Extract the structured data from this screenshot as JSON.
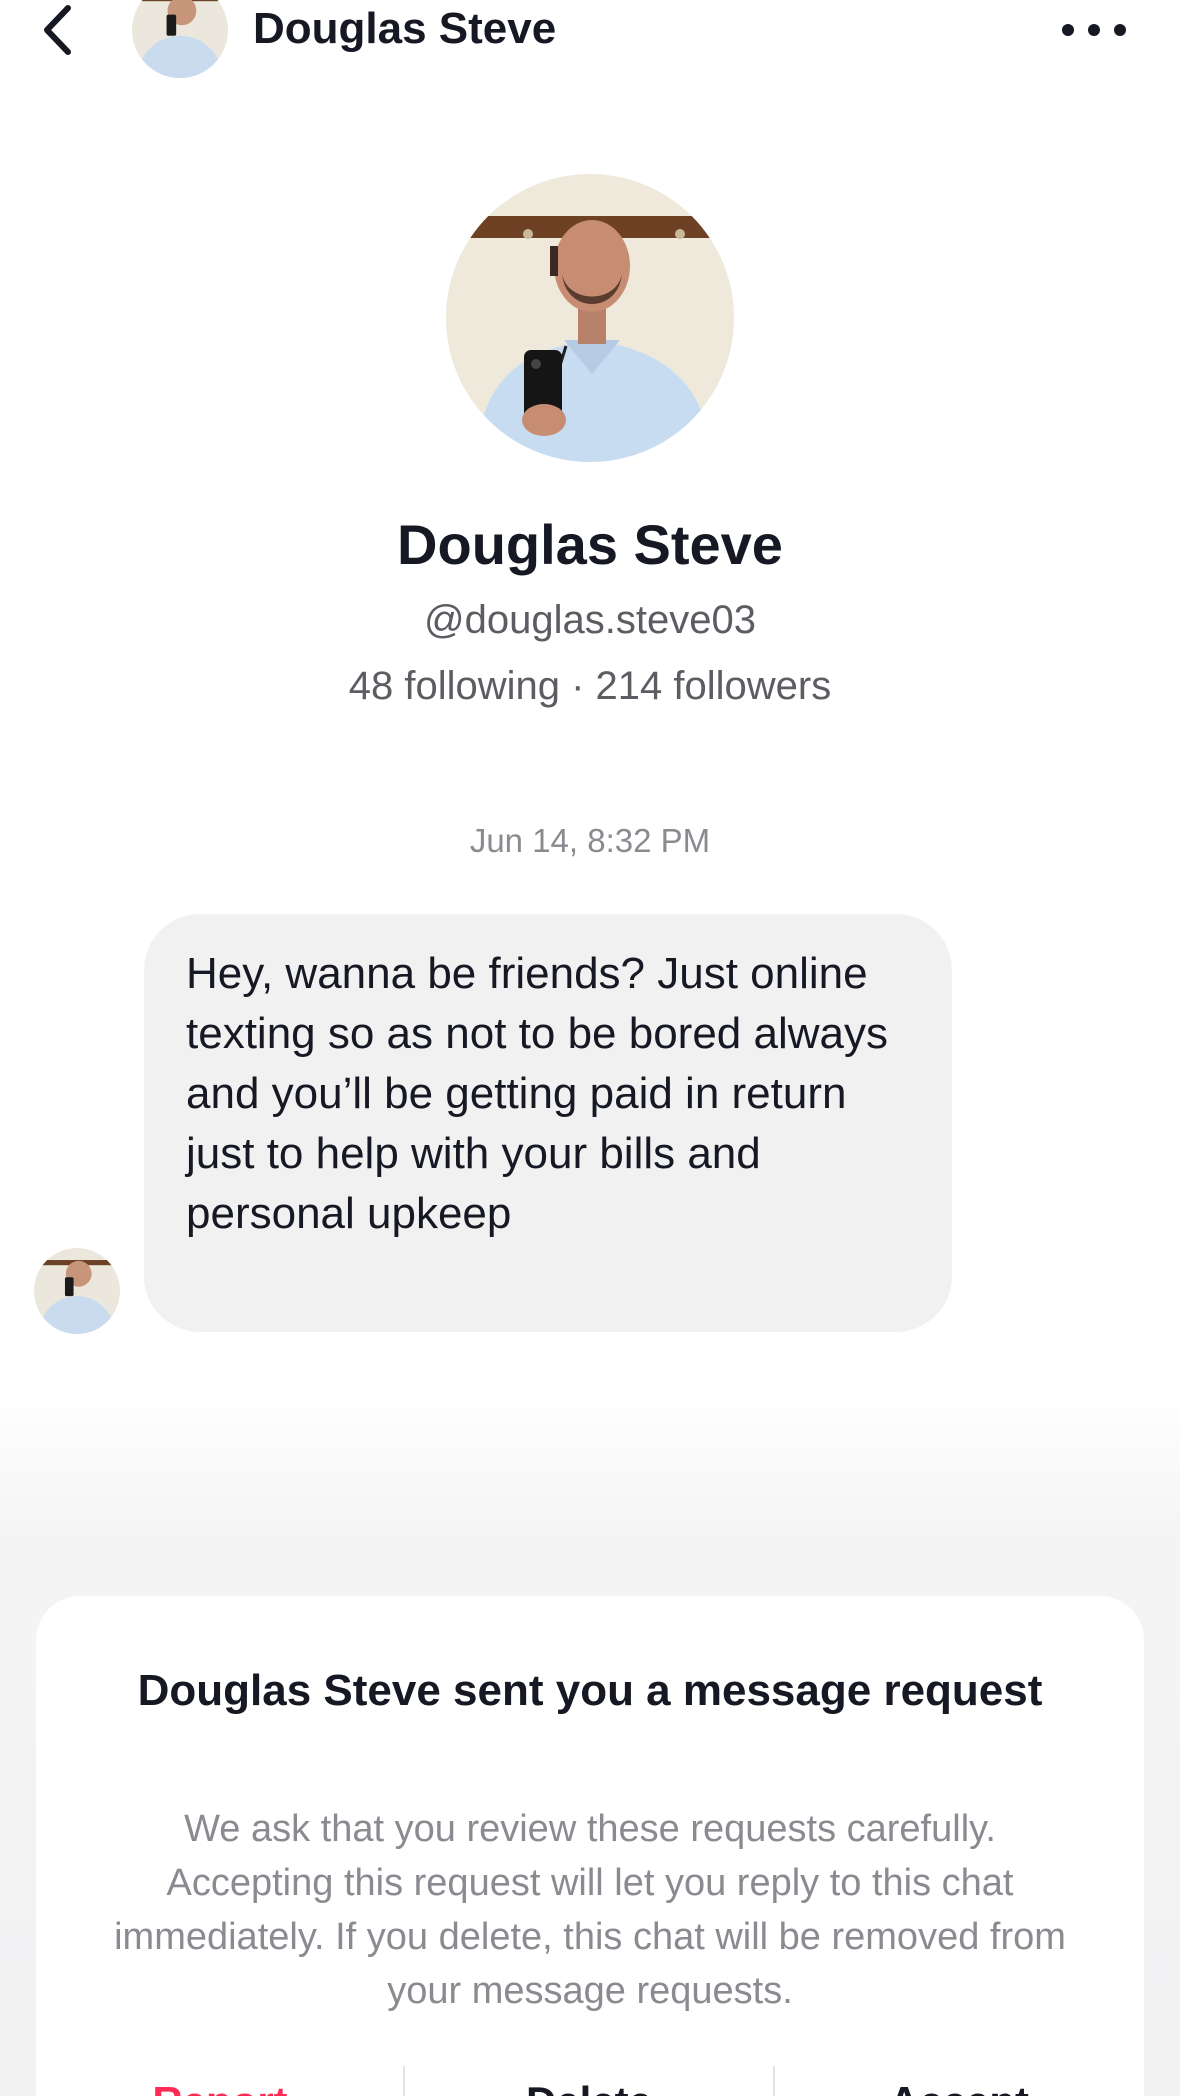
{
  "header": {
    "title": "Douglas Steve"
  },
  "profile": {
    "name": "Douglas Steve",
    "handle": "@douglas.steve03",
    "stats": "48 following · 214 followers"
  },
  "conversation": {
    "timestamp": "Jun 14, 8:32 PM",
    "messages": [
      {
        "text": "Hey, wanna be friends? Just online texting so as not to be bored always and you’ll be getting paid in return just to help with your bills and personal upkeep"
      }
    ]
  },
  "request_card": {
    "title": "Douglas Steve sent you a message request",
    "body": "We ask that you review these requests carefully. Accepting this request will let you reply to this chat immediately. If you delete, this chat will be removed from your message requests.",
    "actions": {
      "report": "Report",
      "delete": "Delete",
      "accept": "Accept"
    }
  },
  "colors": {
    "report_red": "#fe2c55",
    "bubble_bg": "#f1f1f2",
    "secondary_text": "#8a8b91"
  },
  "icons": {
    "back": "chevron-left-icon",
    "more": "more-horizontal-icon"
  }
}
